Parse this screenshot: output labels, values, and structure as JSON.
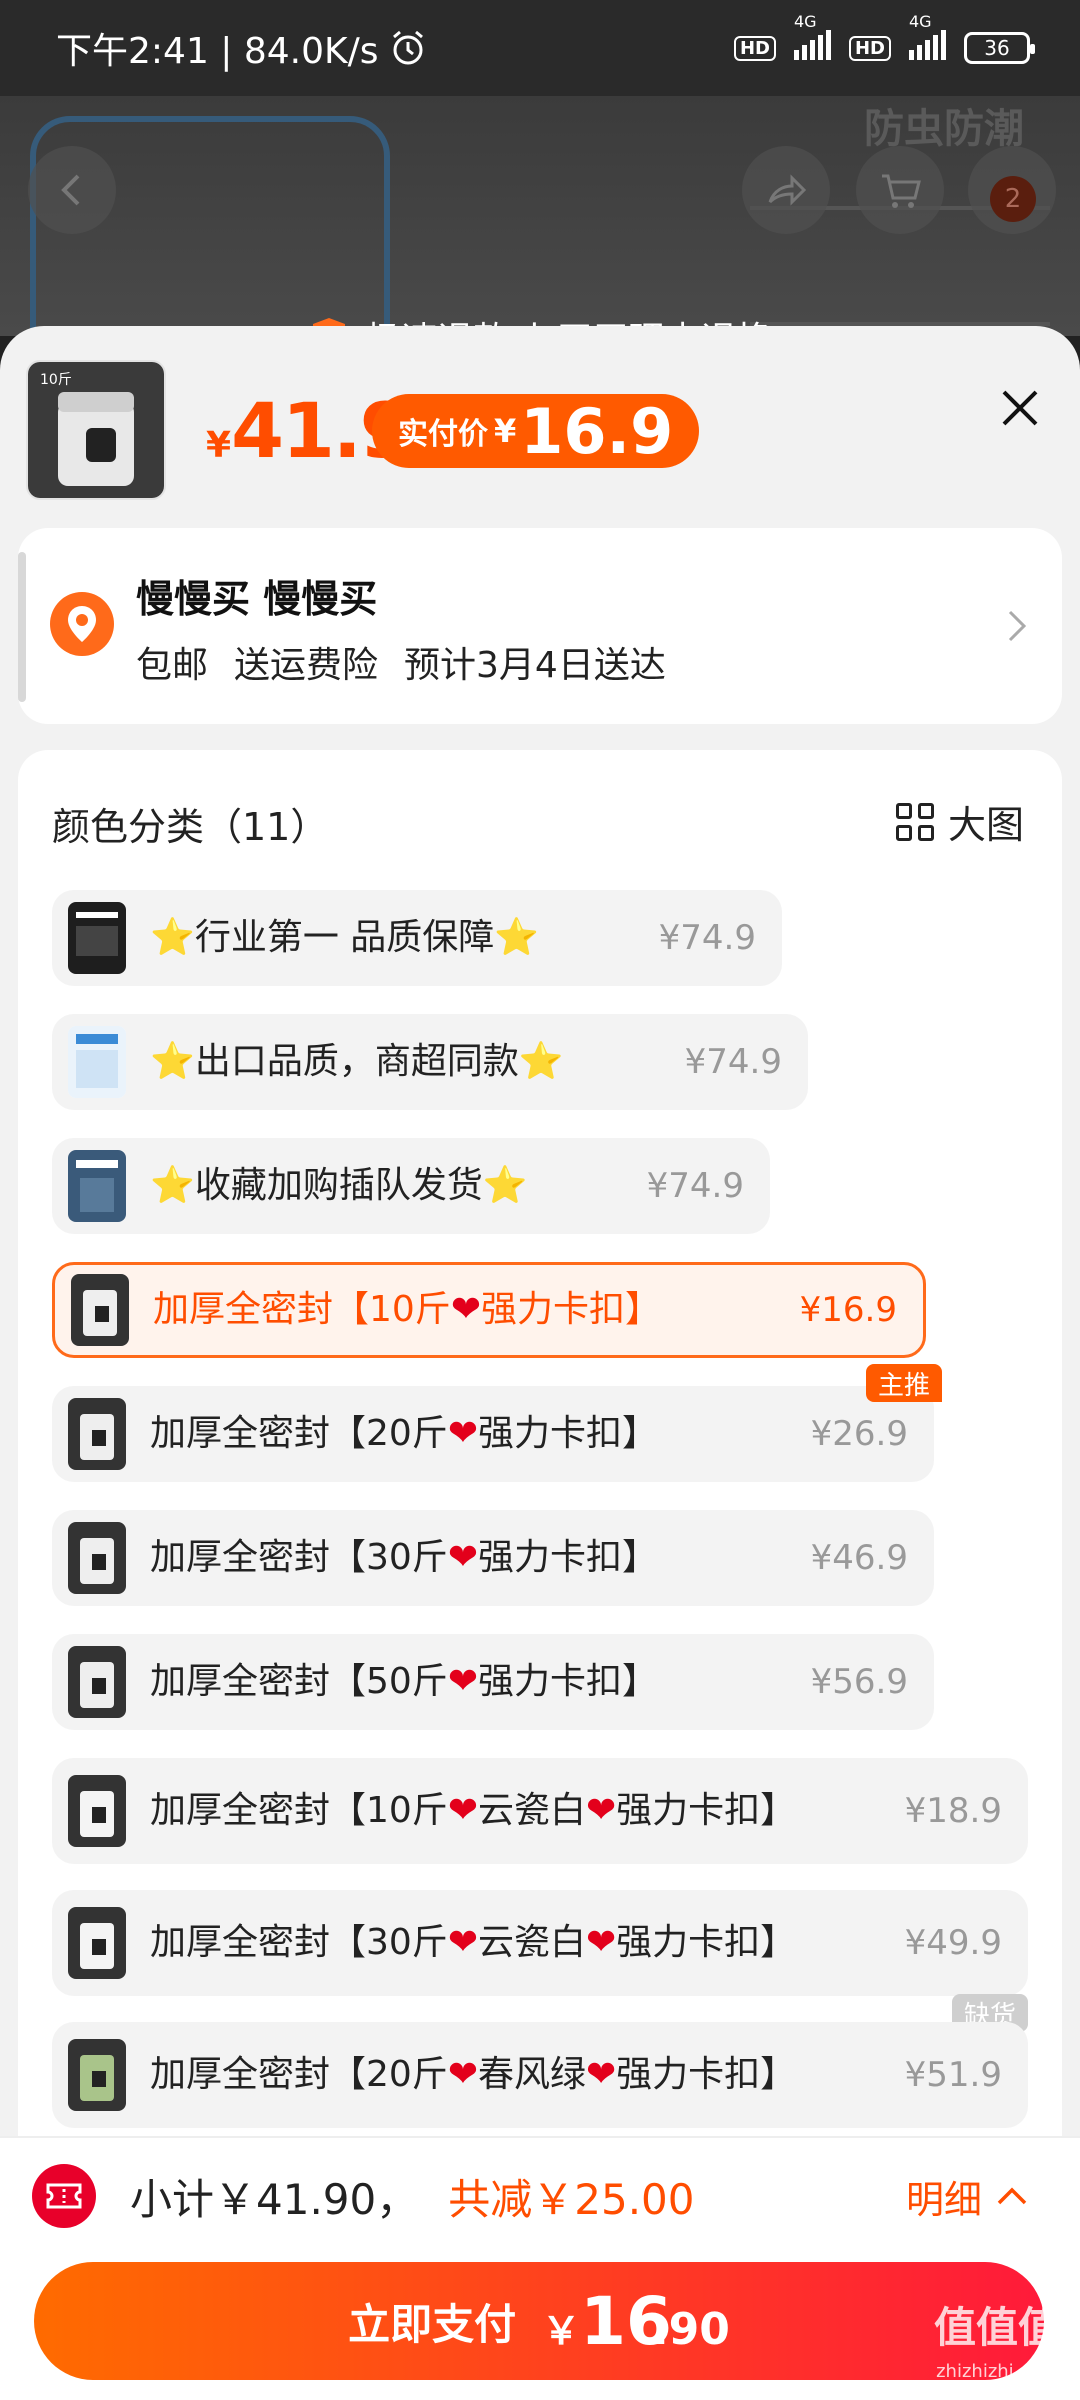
{
  "status_bar": {
    "time": "下午2:41 | 84.0K/s",
    "network": "4G",
    "battery": "36"
  },
  "background": {
    "overlay_text": "防虫防潮",
    "cart_count": "2",
    "refund_text": "极速退款 七天无理由退换"
  },
  "product": {
    "price_yen": "¥",
    "price": "41.9",
    "real_price_label": "实付价",
    "real_price_yen": "¥",
    "real_price": "16.9"
  },
  "address": {
    "name": "慢慢买 慢慢买",
    "tags": [
      "包邮",
      "送运费险",
      "预计3月4日送达"
    ]
  },
  "sku": {
    "title": "颜色分类（11）",
    "big_image_label": "大图",
    "options": [
      {
        "label_parts": [
          "⭐",
          "行业第一 品质保障",
          "⭐"
        ],
        "price": "¥74.9"
      },
      {
        "label_parts": [
          "⭐",
          "出口品质，商超同款",
          "⭐"
        ],
        "price": "¥74.9"
      },
      {
        "label_parts": [
          "⭐",
          "收藏加购插队发货",
          "⭐"
        ],
        "price": "¥74.9"
      },
      {
        "label_parts": [
          "加厚全密封【10斤",
          "❤",
          "强力卡扣】"
        ],
        "price": "¥16.9",
        "selected": true
      },
      {
        "label_parts": [
          "加厚全密封【20斤",
          "❤",
          "强力卡扣】"
        ],
        "price": "¥26.9",
        "tag": "主推"
      },
      {
        "label_parts": [
          "加厚全密封【30斤",
          "❤",
          "强力卡扣】"
        ],
        "price": "¥46.9"
      },
      {
        "label_parts": [
          "加厚全密封【50斤",
          "❤",
          "强力卡扣】"
        ],
        "price": "¥56.9"
      },
      {
        "label_parts": [
          "加厚全密封【10斤",
          "❤",
          "云瓷白",
          "❤",
          "强力卡扣】"
        ],
        "price": "¥18.9"
      },
      {
        "label_parts": [
          "加厚全密封【30斤",
          "❤",
          "云瓷白",
          "❤",
          "强力卡扣】"
        ],
        "price": "¥49.9"
      },
      {
        "label_parts": [
          "加厚全密封【20斤",
          "❤",
          "春风绿",
          "❤",
          "强力卡扣】"
        ],
        "price": "¥51.9",
        "tag": "缺货"
      }
    ]
  },
  "footer": {
    "subtotal": "小计￥41.90，",
    "reduce": "共减￥25.00",
    "detail": "明细",
    "pay_label": "立即支付",
    "pay_yen": "￥",
    "pay_int": "16",
    "pay_dec": ".90"
  },
  "watermark": {
    "text": "值值值",
    "sub": "zhizhizhi.com"
  },
  "colors": {
    "accent": "#ff5a00",
    "pay_end": "#ff1a3a"
  }
}
